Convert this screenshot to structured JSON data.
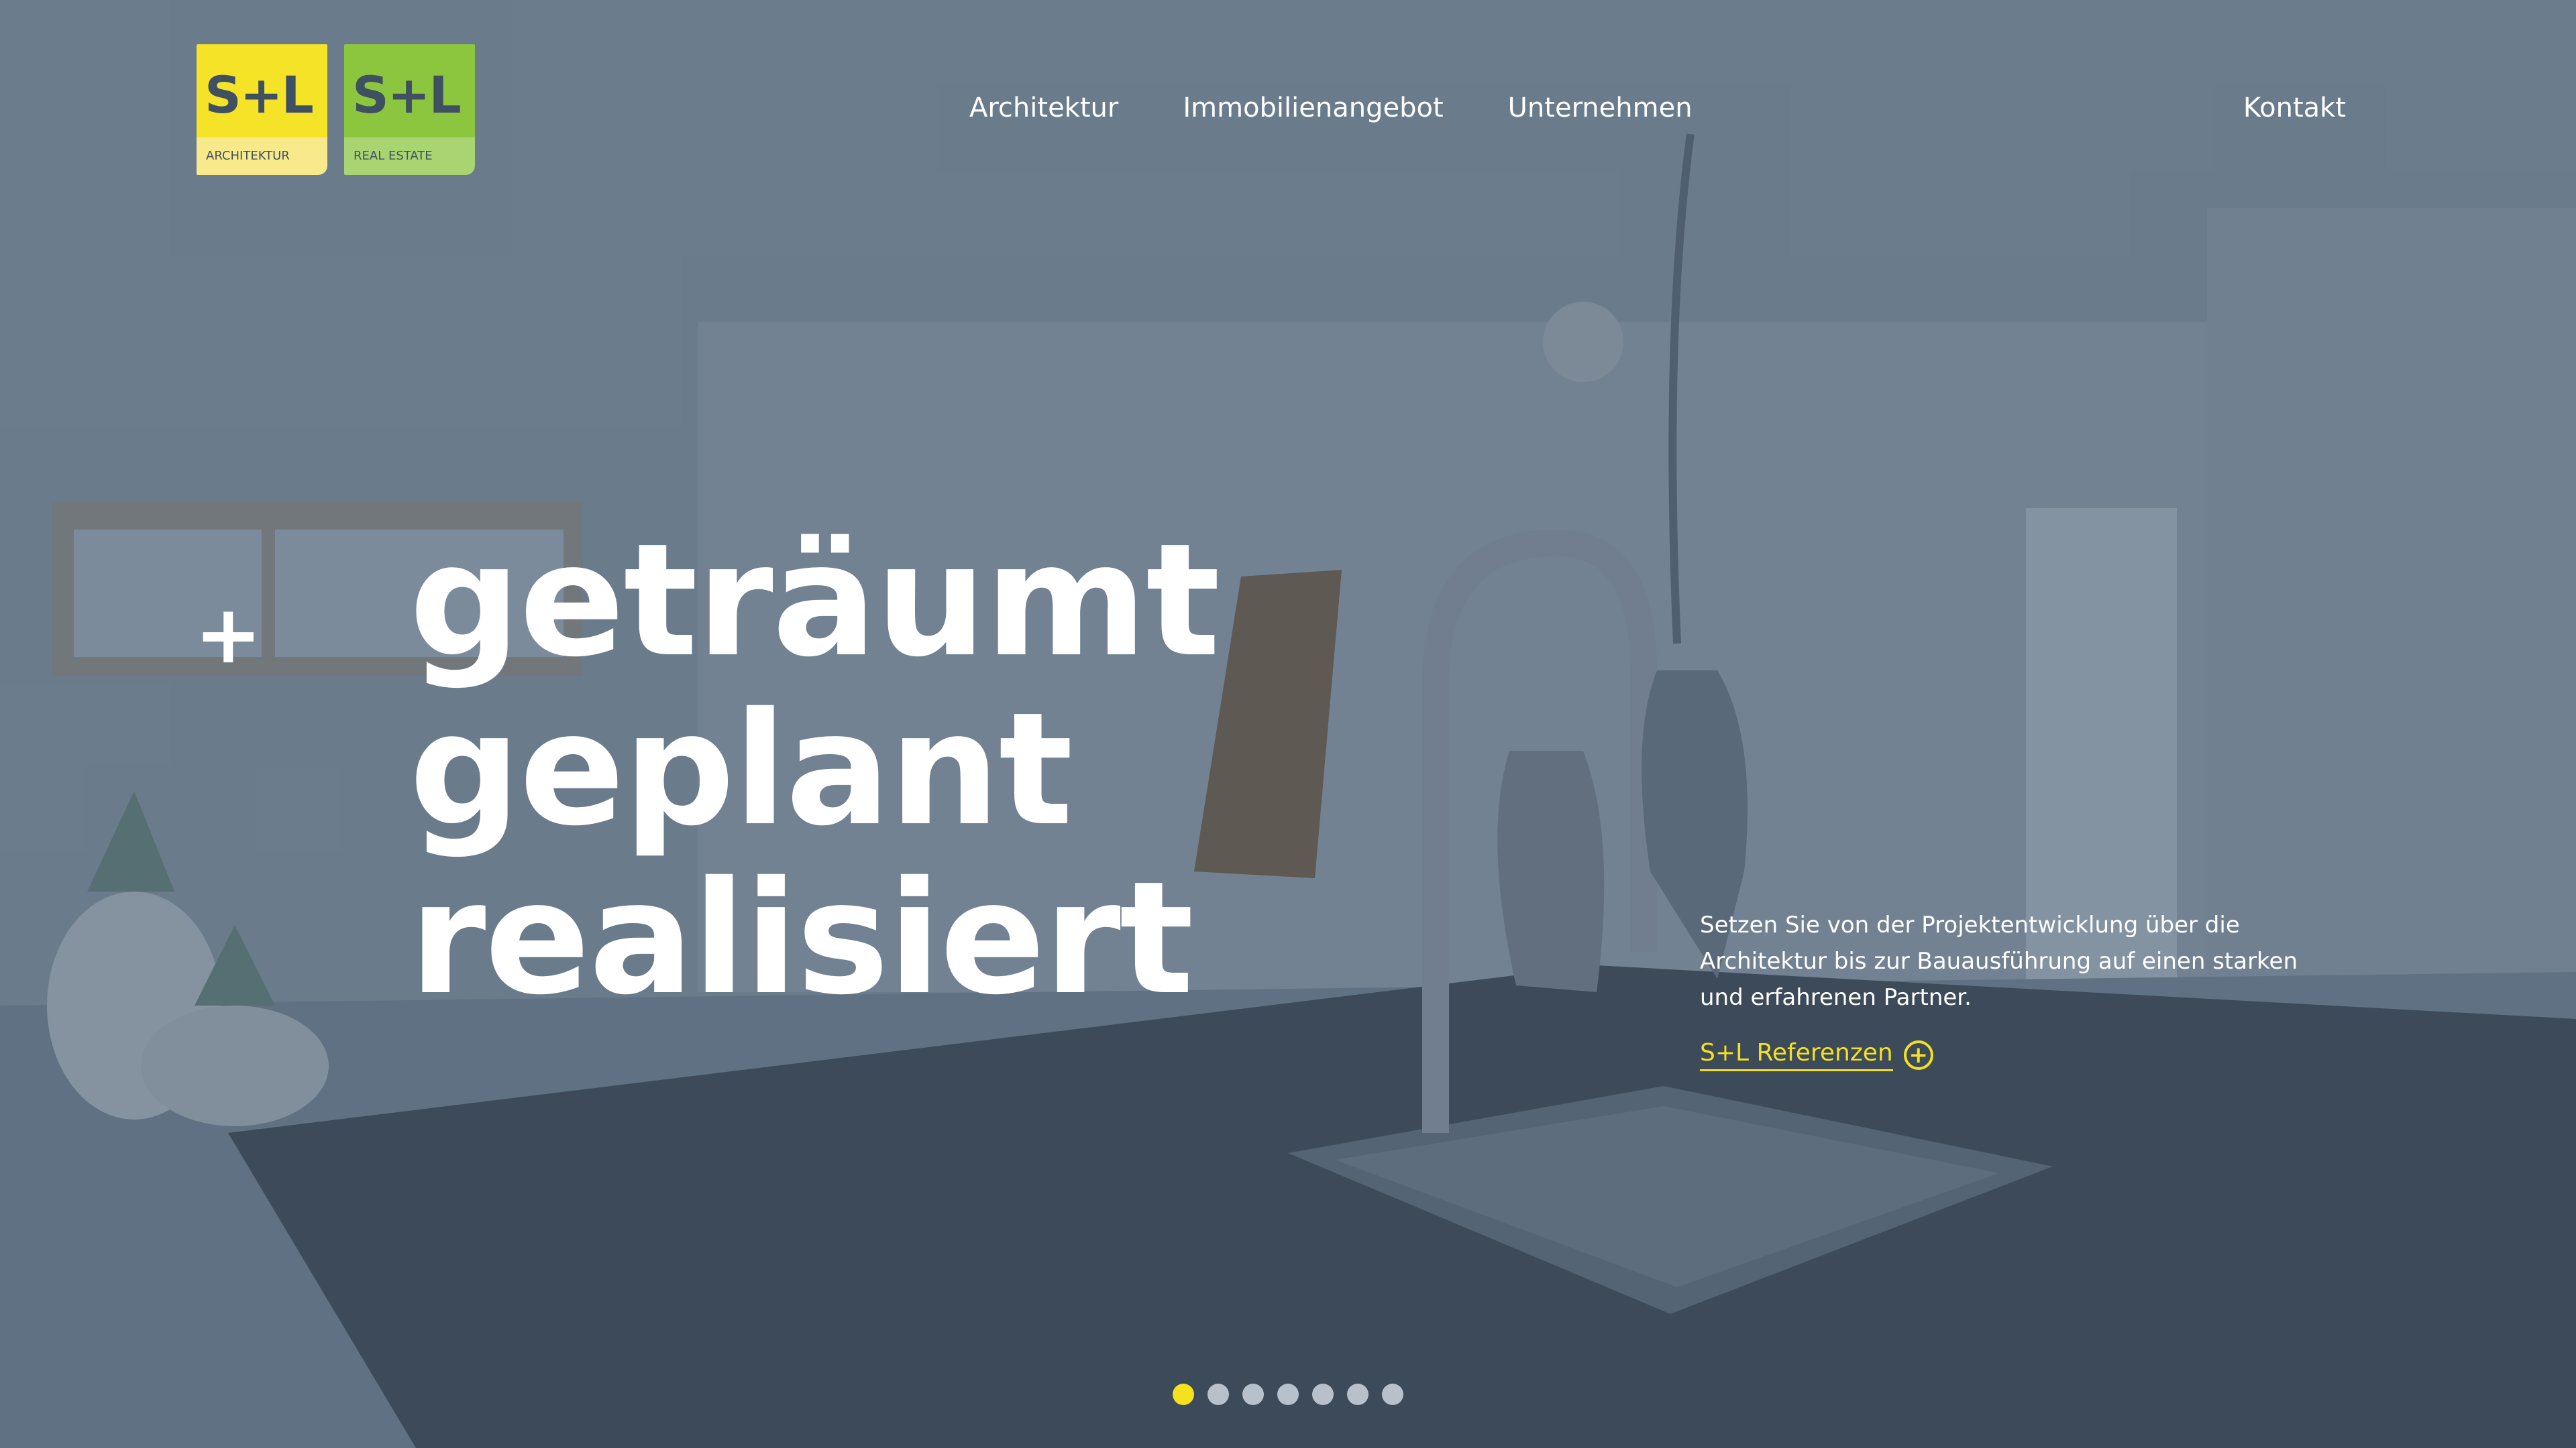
{
  "brand": {
    "logos": [
      {
        "mark": "S+L",
        "subtitle": "ARCHITEKTUR",
        "color": "#f5e327"
      },
      {
        "mark": "S+L",
        "subtitle": "REAL ESTATE",
        "color": "#8cc63f"
      }
    ]
  },
  "nav": {
    "items": [
      {
        "label": "Architektur"
      },
      {
        "label": "Immobilienangebot"
      },
      {
        "label": "Unternehmen"
      }
    ],
    "contact": "Kontakt"
  },
  "hero": {
    "plus_symbol": "+",
    "headline": [
      "geträumt",
      "geplant",
      "realisiert"
    ],
    "intro": "Setzen Sie von der Projektentwicklung über die Architektur bis zur Bauausführung auf einen starken und erfahrenen Partner.",
    "link_label": "S+L Referenzen",
    "link_icon": "plus-circle-icon"
  },
  "slider": {
    "total": 7,
    "active_index": 0
  },
  "colors": {
    "accent": "#f3e022",
    "text": "#ffffff"
  }
}
